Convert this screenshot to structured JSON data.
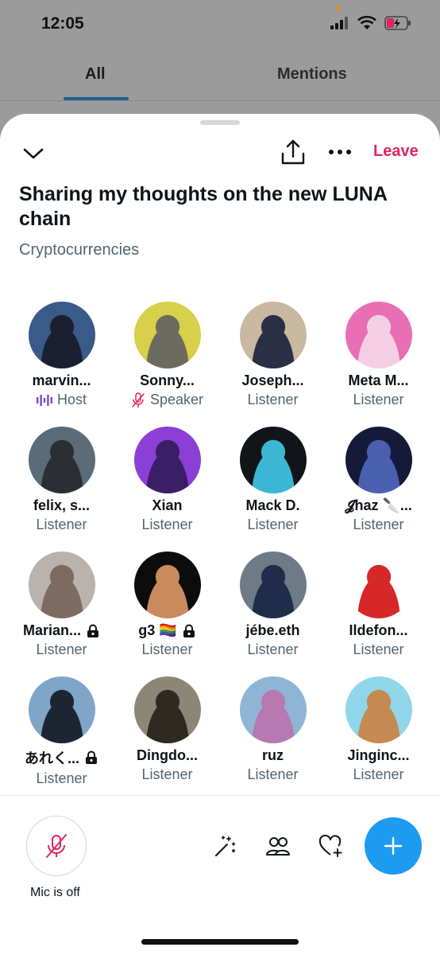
{
  "status": {
    "time": "12:05"
  },
  "background_tabs": [
    "All",
    "Mentions"
  ],
  "header": {
    "leave_label": "Leave"
  },
  "space": {
    "title": "Sharing my thoughts on the new LUNA chain",
    "topic": "Cryptocurrencies"
  },
  "participants": [
    {
      "name": "marvin...",
      "role": "Host",
      "role_icon": "host-waveform-icon",
      "avatar_colors": [
        "#3a5a8a",
        "#1b2030"
      ],
      "locked": false
    },
    {
      "name": "Sonny...",
      "role": "Speaker",
      "role_icon": "mic-muted-icon",
      "avatar_colors": [
        "#d8cf4a",
        "#6d6a5f"
      ],
      "locked": false
    },
    {
      "name": "Joseph...",
      "role": "Listener",
      "avatar_colors": [
        "#c9b9a0",
        "#2a2f45"
      ],
      "locked": false
    },
    {
      "name": "Meta M...",
      "role": "Listener",
      "avatar_colors": [
        "#e86fb4",
        "#f4cfe3"
      ],
      "locked": false
    },
    {
      "name": "felix, s...",
      "role": "Listener",
      "avatar_colors": [
        "#5b6b78",
        "#2b2e33"
      ],
      "locked": false
    },
    {
      "name": "Xian",
      "role": "Listener",
      "avatar_colors": [
        "#8c3fd6",
        "#3b1f66"
      ],
      "locked": false
    },
    {
      "name": "Mack D.",
      "role": "Listener",
      "avatar_colors": [
        "#111418",
        "#3bb7d4"
      ],
      "locked": false
    },
    {
      "name": "𝓙haz 🔪...",
      "role": "Listener",
      "avatar_colors": [
        "#161a3a",
        "#4a5fb0"
      ],
      "locked": false
    },
    {
      "name": "Marian...",
      "role": "Listener",
      "avatar_colors": [
        "#b9b2ad",
        "#7d6a60"
      ],
      "locked": true
    },
    {
      "name": "g3 🏳️‍🌈",
      "role": "Listener",
      "avatar_colors": [
        "#0c0c0c",
        "#c98a5e"
      ],
      "locked": true
    },
    {
      "name": "jébe.eth",
      "role": "Listener",
      "avatar_colors": [
        "#6e7b86",
        "#1f2c4a"
      ],
      "locked": false
    },
    {
      "name": "Ildefon...",
      "role": "Listener",
      "avatar_colors": [
        "#ffffff",
        "#d62828"
      ],
      "locked": false
    },
    {
      "name": "あれく...",
      "role": "Listener",
      "avatar_colors": [
        "#7fa6c9",
        "#1d2533"
      ],
      "locked": true
    },
    {
      "name": "Dingdo...",
      "role": "Listener",
      "avatar_colors": [
        "#8c8677",
        "#2e2a22"
      ],
      "locked": false
    },
    {
      "name": "ruz",
      "role": "Listener",
      "avatar_colors": [
        "#8fb5d6",
        "#b67ab0"
      ],
      "locked": false
    },
    {
      "name": "Jinginc...",
      "role": "Listener",
      "avatar_colors": [
        "#8fd6ea",
        "#c48a52"
      ],
      "locked": false
    }
  ],
  "bottom": {
    "mic_label": "Mic is off"
  },
  "colors": {
    "accent": "#1d9bf0",
    "leave": "#e0245e",
    "host": "#794bc4",
    "muted": "#e0245e"
  }
}
